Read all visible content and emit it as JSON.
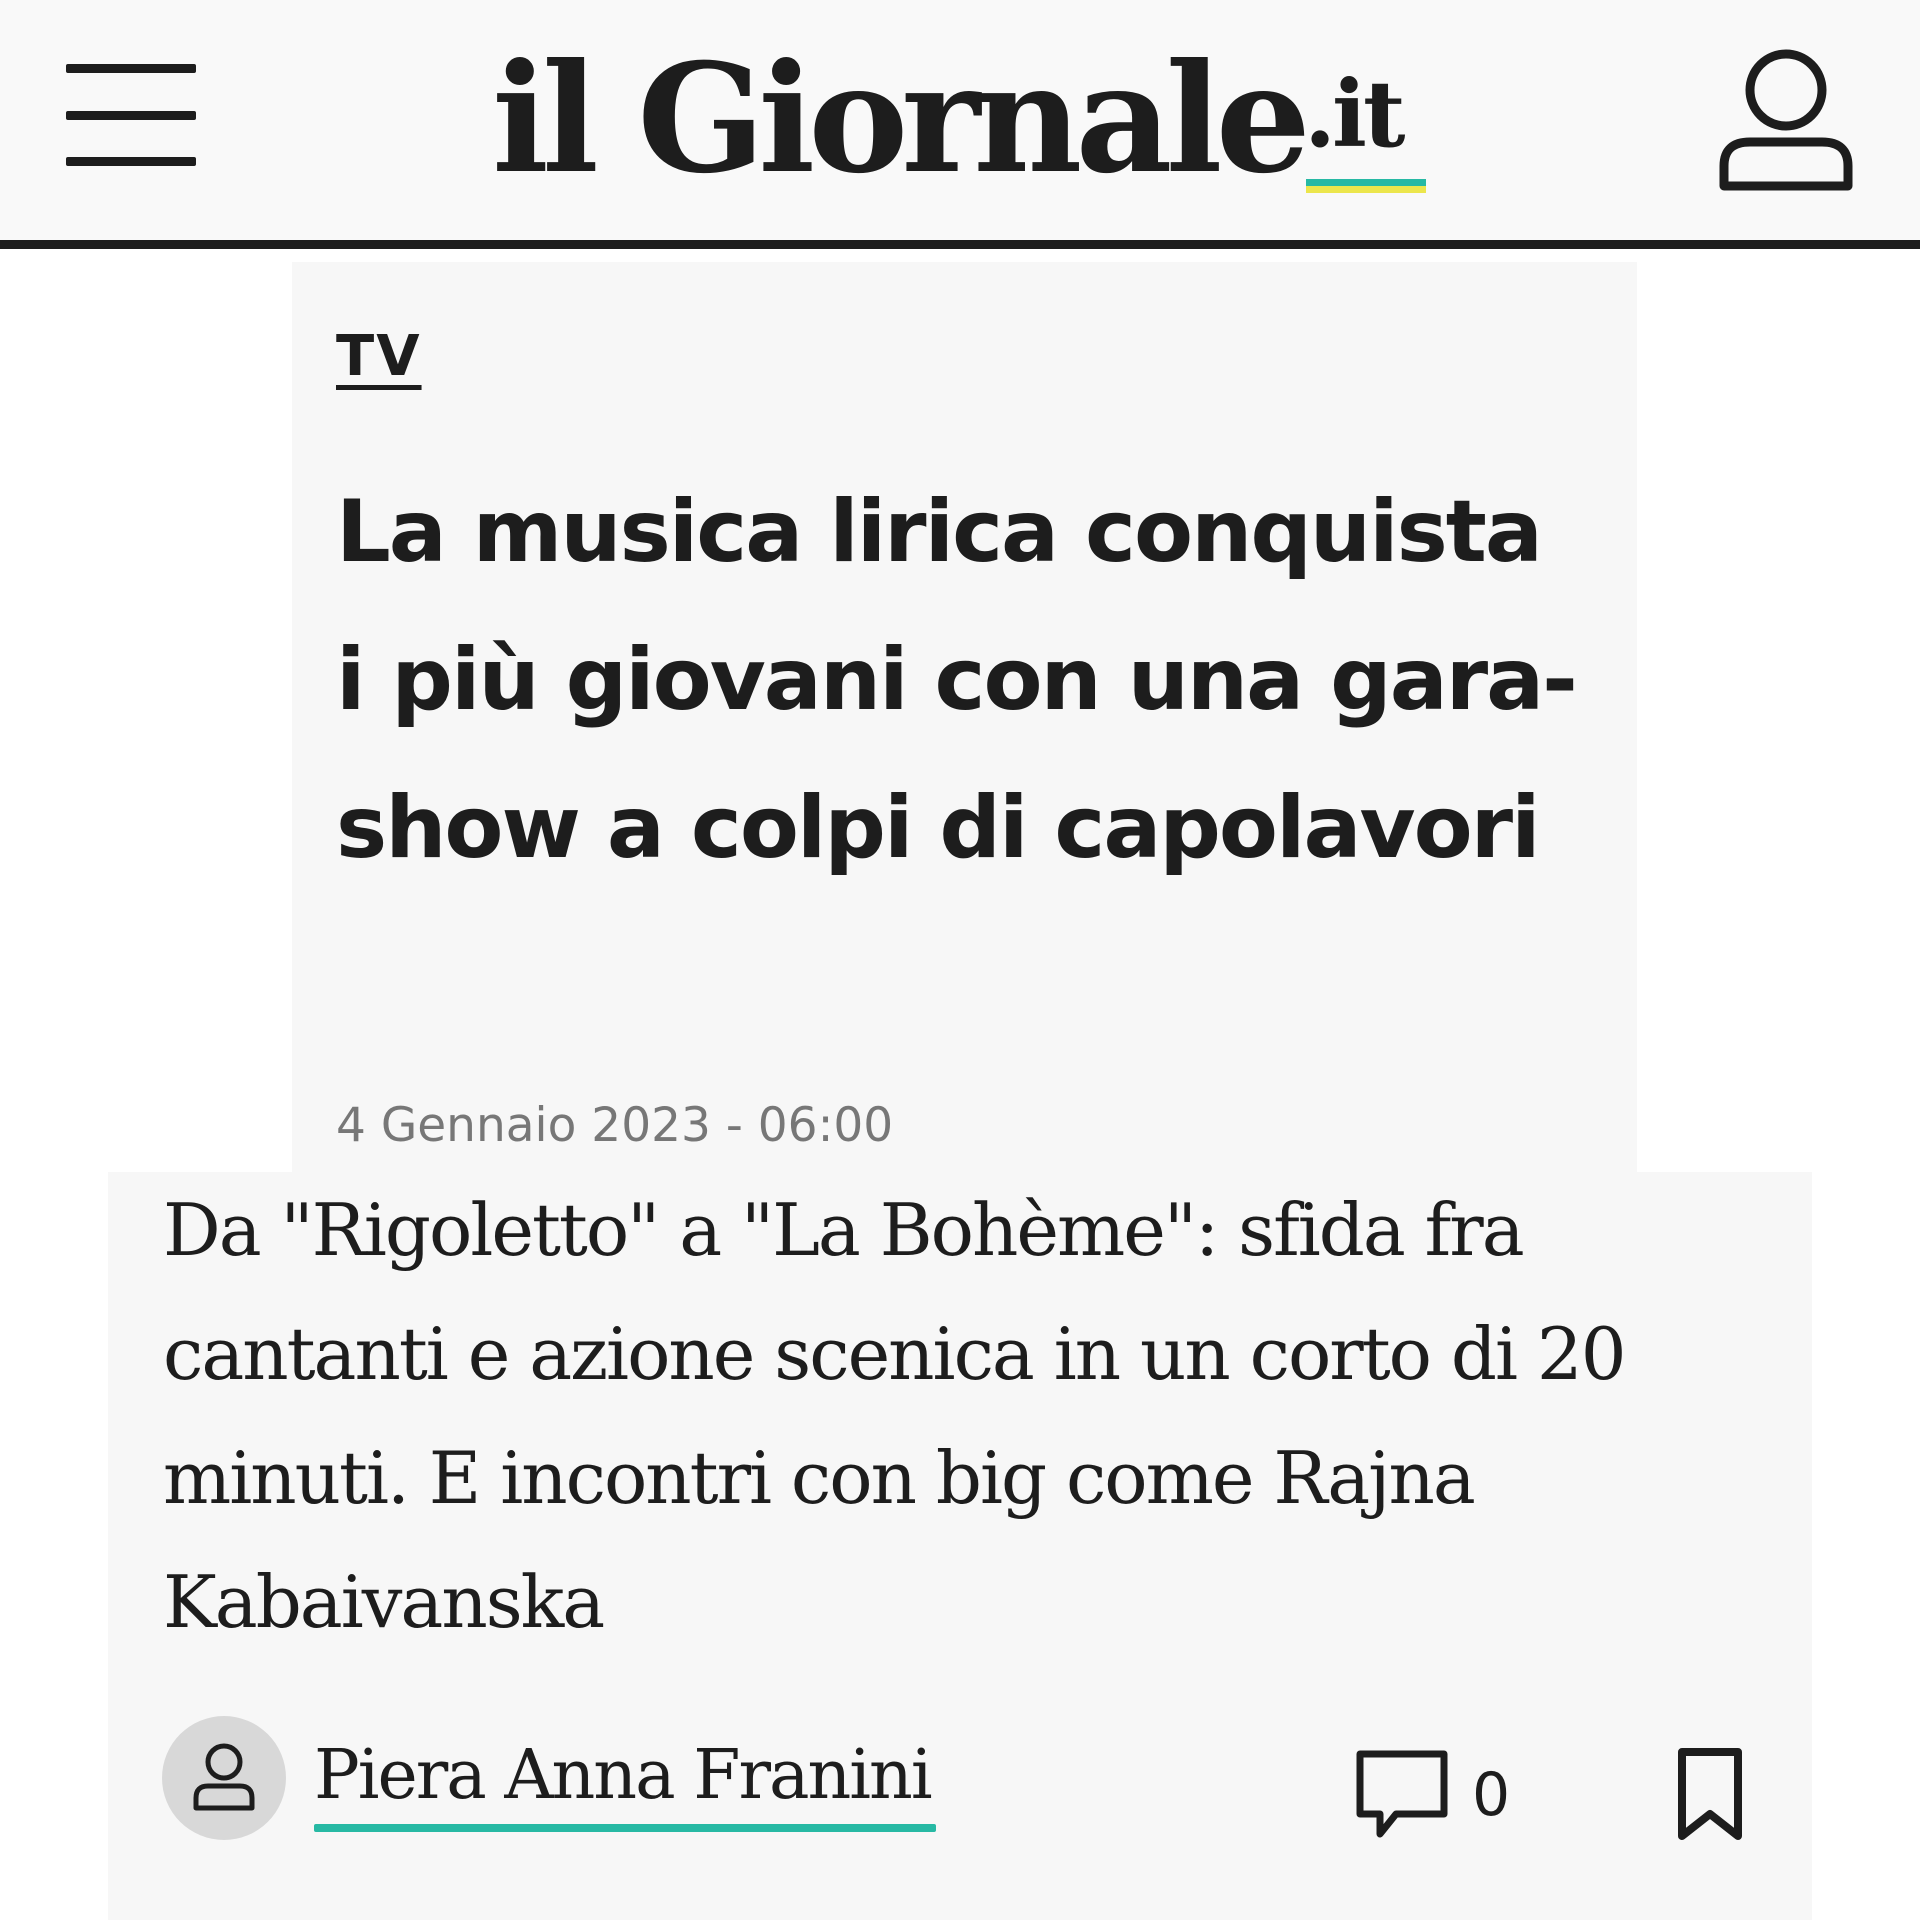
{
  "header": {
    "logo_main": "il Giornale",
    "logo_tld": ".it",
    "menu_icon": "hamburger-menu-icon",
    "user_icon": "user-icon"
  },
  "article": {
    "category": "TV",
    "title": "La musica lirica conquista i più giovani con una gara-show a colpi di capolavori",
    "date": "4 Gennaio 2023 - 06:00",
    "summary": "Da \"Rigoletto\" a \"La Bohème\": sfida fra cantanti e azione scenica in un corto di 20 minuti. E incontri con big come Rajna Kabaivanska",
    "author": "Piera Anna Franini",
    "comment_count": "0"
  },
  "icons": {
    "author_avatar": "person-icon",
    "comments": "comment-icon",
    "bookmark": "bookmark-icon"
  },
  "colors": {
    "accent_teal": "#27b9a4",
    "accent_yellow": "#ece64c",
    "text": "#1d1d1d",
    "muted": "#777777",
    "block_bg": "#f7f7f7"
  }
}
